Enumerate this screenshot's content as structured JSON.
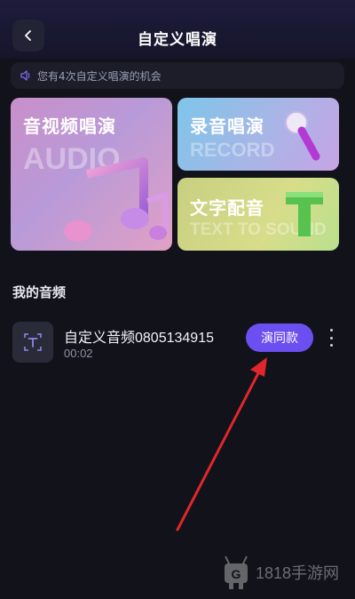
{
  "header": {
    "title": "自定义唱演"
  },
  "notice": {
    "text": "您有4次自定义唱演的机会"
  },
  "cards": {
    "audio": {
      "title": "音视频唱演",
      "subtitle": "AUDIO"
    },
    "record": {
      "title": "录音唱演",
      "subtitle": "RECORD"
    },
    "text": {
      "title": "文字配音",
      "subtitle": "TEXT TO SOUND"
    }
  },
  "section": {
    "title": "我的音频"
  },
  "audio_list": [
    {
      "name": "自定义音频0805134915",
      "duration": "00:02",
      "action_label": "演同款"
    }
  ],
  "watermark": {
    "text": "1818手游网"
  },
  "colors": {
    "accent": "#6c4ff0",
    "background": "#11121a",
    "arrow": "#e0262c"
  },
  "icons": {
    "back": "chevron-left-icon",
    "notice": "speaker-icon",
    "thumb": "text-t-icon",
    "more": "more-vertical-icon"
  }
}
